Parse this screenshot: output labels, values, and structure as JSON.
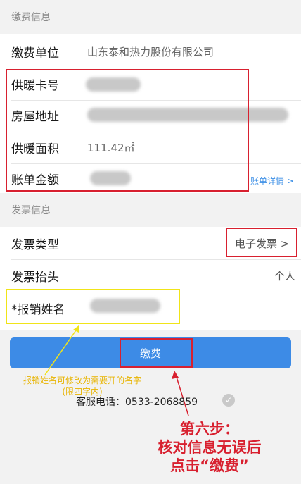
{
  "fee_section": {
    "header": "缴费信息",
    "unit_label": "缴费单位",
    "unit_value": "山东泰和热力股份有限公司",
    "card_label": "供暖卡号",
    "address_label": "房屋地址",
    "area_label": "供暖面积",
    "area_value": "111.42㎡",
    "amount_label": "账单金额",
    "bill_detail_link": "账单详情 >"
  },
  "invoice_section": {
    "header": "发票信息",
    "type_label": "发票类型",
    "type_value": "电子发票 >",
    "title_label": "发票抬头",
    "title_value": "个人",
    "reimb_label": "*报销姓名"
  },
  "pay_button": "缴费",
  "annotations": {
    "yellow_note_line1": "报销姓名可修改为需要开的名字",
    "yellow_note_line2": "(限四字内)",
    "step_line1": "第六步：",
    "step_line2": "核对信息无误后",
    "step_line3": "点击“缴费”"
  },
  "service_phone": "客服电话：0533-2068859",
  "colors": {
    "accent": "#3d8be6",
    "annotation_red": "#d8202f",
    "annotation_yellow": "#f0e418"
  }
}
